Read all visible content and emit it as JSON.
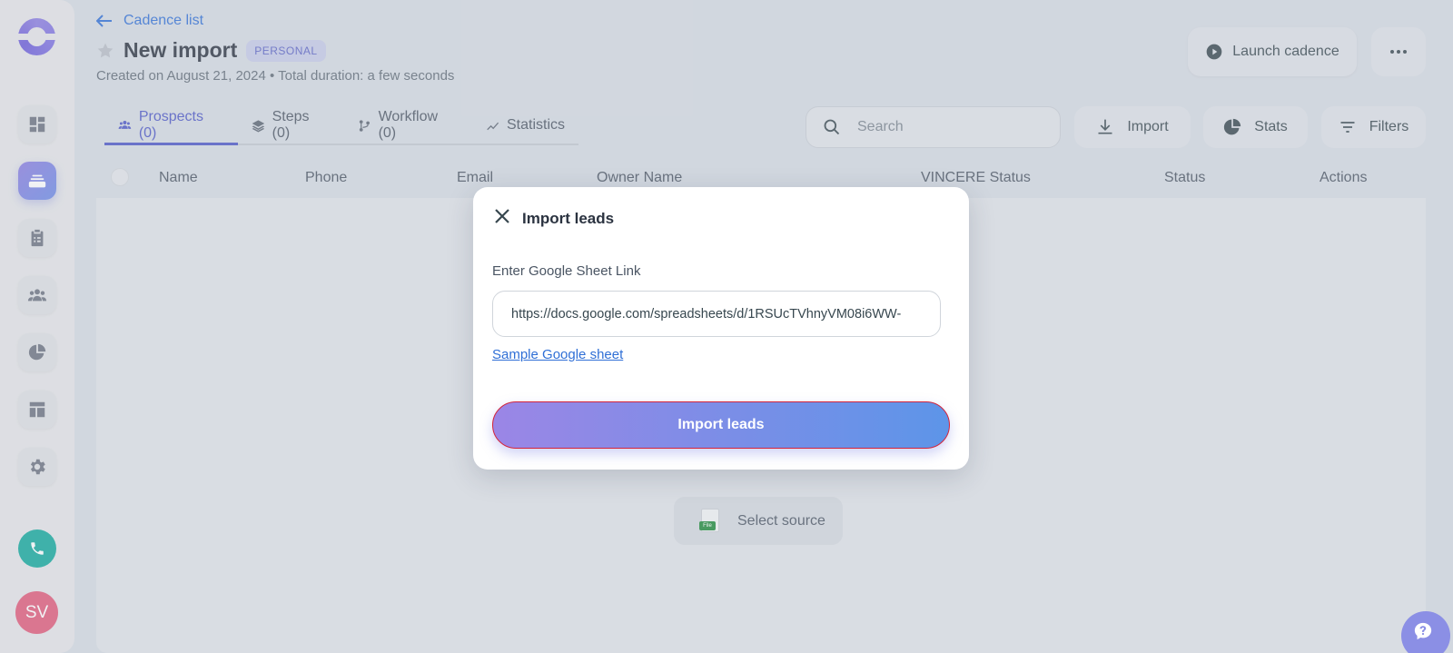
{
  "sidebar": {
    "avatar_initials": "SV",
    "active_item": "cadences",
    "items": [
      {
        "name": "dashboard",
        "icon": "dashboard-icon"
      },
      {
        "name": "cadences",
        "icon": "cadence-stack-icon"
      },
      {
        "name": "tasks",
        "icon": "clipboard-icon"
      },
      {
        "name": "people",
        "icon": "people-icon"
      },
      {
        "name": "reports",
        "icon": "pie-chart-icon"
      },
      {
        "name": "templates",
        "icon": "layout-icon"
      },
      {
        "name": "settings",
        "icon": "gear-icon"
      }
    ]
  },
  "header": {
    "back_label": "Cadence list",
    "title": "New import",
    "badge": "PERSONAL",
    "subtitle": "Created on August 21, 2024 • Total duration: a few seconds",
    "launch_label": "Launch cadence"
  },
  "tabs": [
    {
      "label": "Prospects (0)",
      "icon": "people-icon",
      "active": true
    },
    {
      "label": "Steps (0)",
      "icon": "layers-icon",
      "active": false
    },
    {
      "label": "Workflow (0)",
      "icon": "workflow-icon",
      "active": false
    },
    {
      "label": "Statistics",
      "icon": "trend-icon",
      "active": false
    }
  ],
  "toolbar": {
    "search_placeholder": "Search",
    "import_label": "Import",
    "stats_label": "Stats",
    "filters_label": "Filters"
  },
  "table": {
    "columns": [
      "Name",
      "Phone",
      "Email",
      "Owner Name",
      "VINCERE Status",
      "Status",
      "Actions"
    ]
  },
  "empty_state": {
    "file_tag": "File",
    "source_label": "Select source"
  },
  "modal": {
    "title": "Import leads",
    "field_label": "Enter Google Sheet Link",
    "sheet_url": "https://docs.google.com/spreadsheets/d/1RSUcTVhnyVM08i6WW-",
    "sample_link": "Sample Google sheet",
    "submit_label": "Import leads"
  },
  "colors": {
    "accent": "#4b56c6",
    "link": "#2f6fd6",
    "phone": "#12a89c",
    "avatar": "#e05a7a",
    "button_gradient_start": "#9b86e6",
    "button_gradient_end": "#5d95e8",
    "focus_border": "#d4243a"
  }
}
